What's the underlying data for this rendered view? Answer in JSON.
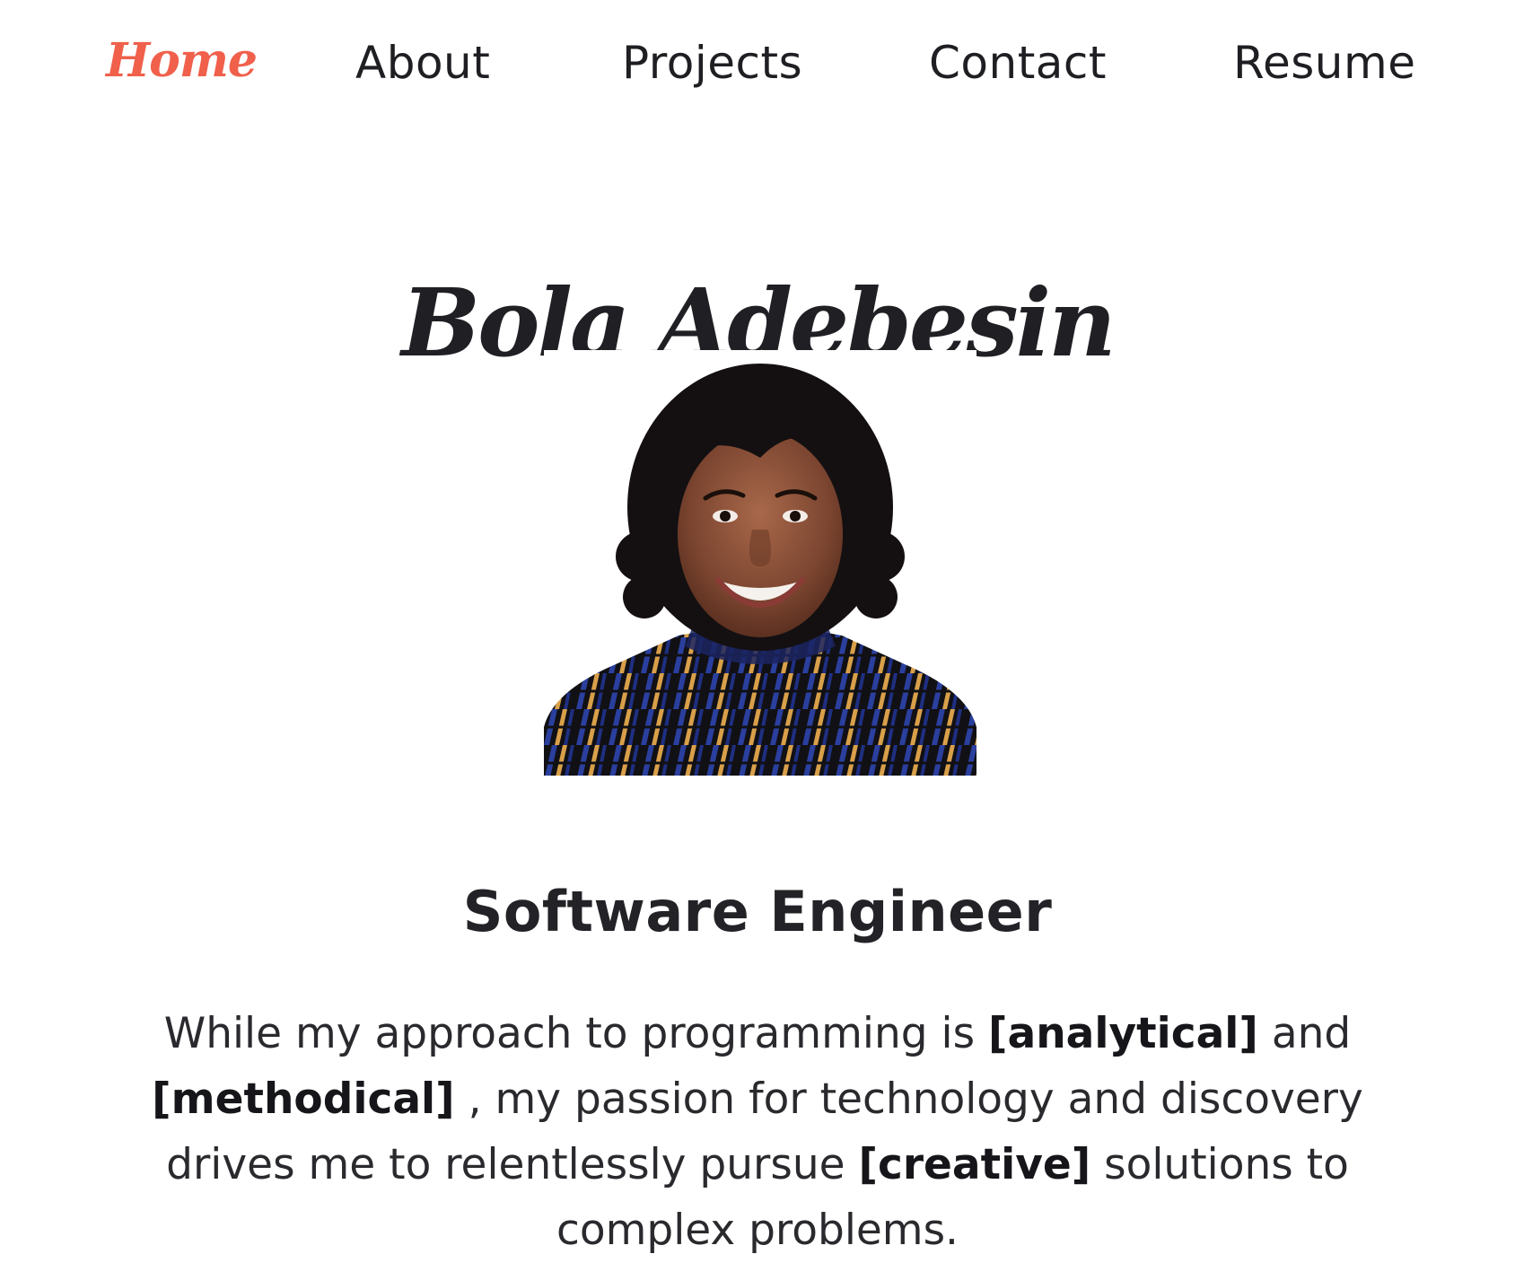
{
  "nav": {
    "items": [
      {
        "label": "Home",
        "active": true
      },
      {
        "label": "About",
        "active": false
      },
      {
        "label": "Projects",
        "active": false
      },
      {
        "label": "Contact",
        "active": false
      },
      {
        "label": "Resume",
        "active": false
      }
    ],
    "active_color": "#f0604b"
  },
  "hero": {
    "name": "Bola Adebesin",
    "subtitle": "Software Engineer",
    "bio": {
      "p1": "While my approach to programming is ",
      "k1": "[analytical]",
      "p2": " and ",
      "k2": "[methodical]",
      "p3": " , my passion for technology and discovery drives me to relentlessly pursue ",
      "k3": "[creative]",
      "p4": " solutions to complex problems."
    }
  },
  "icons": {
    "portrait": "profile-photo"
  }
}
